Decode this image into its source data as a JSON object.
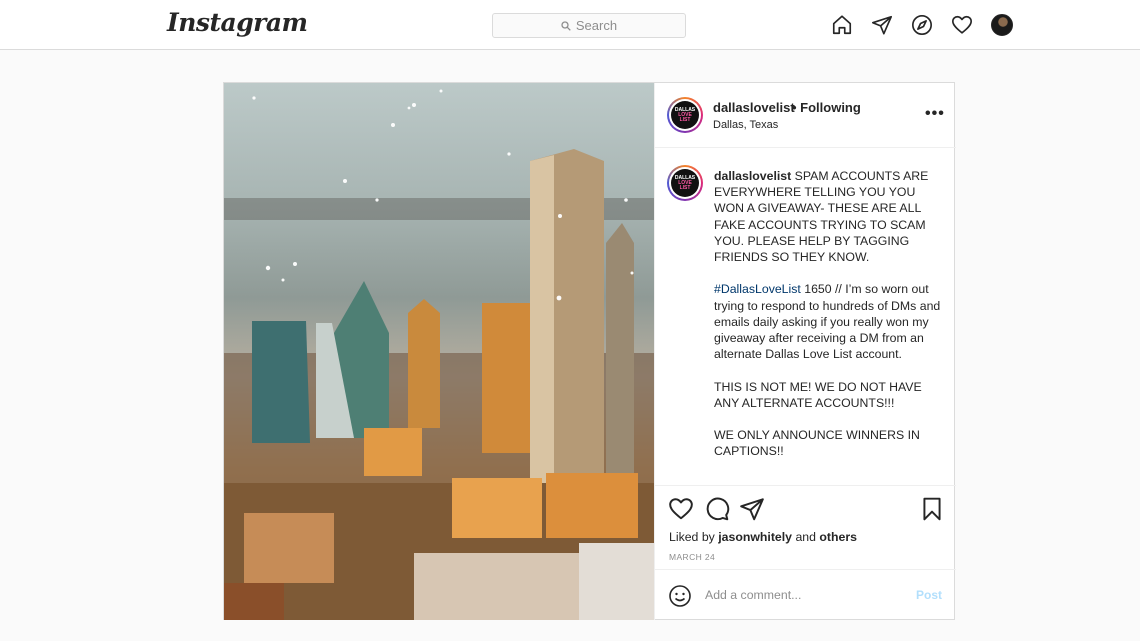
{
  "nav": {
    "logo": "Instagram",
    "search_placeholder": "Search",
    "icons": [
      "home-icon",
      "direct-message-icon",
      "explore-icon",
      "activity-heart-icon",
      "profile-avatar"
    ]
  },
  "post": {
    "username": "dallaslovelist",
    "follow_status": "• Following",
    "location": "Dallas, Texas",
    "avatar_text": [
      "DALLAS",
      "LOVE",
      "LIST"
    ],
    "caption": {
      "username": "dallaslovelist",
      "lead": "SPAM ACCOUNTS ARE EVERYWHERE TELLING YOU YOU WON A GIVEAWAY- THESE ARE ALL FAKE ACCOUNTS TRYING TO SCAM YOU. PLEASE HELP BY TAGGING FRIENDS SO THEY KNOW.",
      "hashtag": "#DallasLoveList",
      "para2": " 1650 // I’m so worn out trying to respond to hundreds of DMs and emails daily asking if you really won my giveaway after receiving a DM from an alternate Dallas Love List account.",
      "para3": "THIS IS NOT ME! WE DO NOT HAVE ANY ALTERNATE ACCOUNTS!!!",
      "para4": "WE ONLY ANNOUNCE WINNERS IN CAPTIONS!!"
    },
    "liked_by_prefix": "Liked by ",
    "liked_by_user": "jasonwhitely",
    "liked_by_and": " and ",
    "liked_by_others": "others",
    "date": "MARCH 24",
    "comment_placeholder": "Add a comment...",
    "post_button": "Post",
    "colors": {
      "link": "#00376b",
      "post_disabled": "#b2dffc",
      "border": "#dbdbdb"
    }
  }
}
